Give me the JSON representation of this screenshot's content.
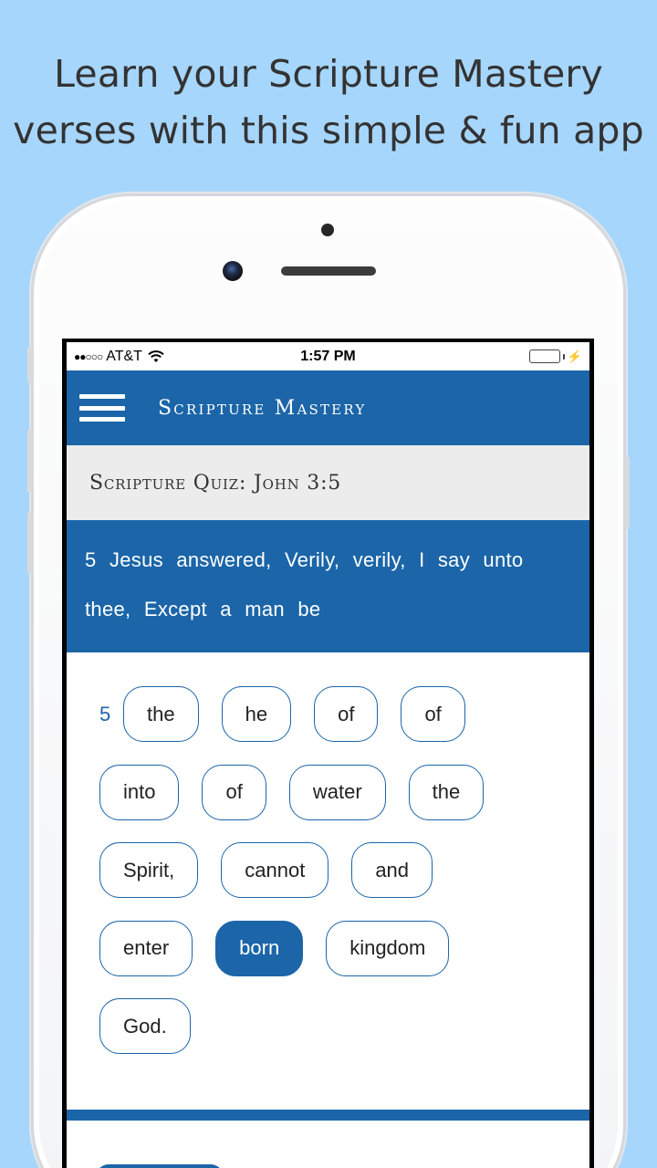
{
  "promo": {
    "line1": "Learn your Scripture Mastery",
    "line2": "verses with this simple & fun app"
  },
  "status_bar": {
    "signal": "●●○○○",
    "carrier": "AT&T",
    "time": "1:57 PM",
    "battery_level": 1.0,
    "charging_icon": "bolt-icon"
  },
  "navbar": {
    "menu_icon": "hamburger-icon",
    "title": "Scripture Mastery"
  },
  "quiz": {
    "header": "Scripture Quiz: John 3:5",
    "verse_text": "5 Jesus answered, Verily, verily, I say unto thee, Except a man be",
    "verse_number": "5",
    "word_rows": [
      [
        "the",
        "he",
        "of",
        "of"
      ],
      [
        "into",
        "of",
        "water",
        "the"
      ],
      [
        "Spirit,",
        "cannot",
        "and"
      ],
      [
        "enter",
        "born",
        "kingdom"
      ],
      [
        "God."
      ]
    ],
    "selected_word": "born"
  },
  "colors": {
    "background": "#a6d6fc",
    "accent": "#1b65a8",
    "header_gray": "#ececec"
  }
}
